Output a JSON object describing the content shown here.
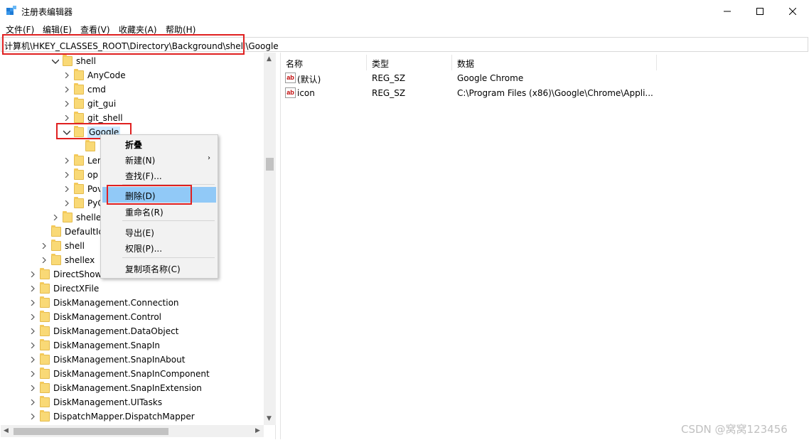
{
  "window": {
    "title": "注册表编辑器",
    "minimize_icon": "minimize-icon",
    "maximize_icon": "maximize-icon",
    "close_icon": "close-icon"
  },
  "menubar": [
    "文件(F)",
    "编辑(E)",
    "查看(V)",
    "收藏夹(A)",
    "帮助(H)"
  ],
  "address": "计算机\\HKEY_CLASSES_ROOT\\Directory\\Background\\shell\\Google",
  "tree": [
    {
      "label": "shell",
      "expanded": true
    },
    {
      "label": "AnyCode"
    },
    {
      "label": "cmd"
    },
    {
      "label": "git_gui"
    },
    {
      "label": "git_shell"
    },
    {
      "label": "Google",
      "expanded": true,
      "selected": true
    },
    {
      "label": ""
    },
    {
      "label": "Ler"
    },
    {
      "label": "op"
    },
    {
      "label": "Pov"
    },
    {
      "label": "PyC"
    },
    {
      "label": "shelle"
    },
    {
      "label": "DefaultIc"
    },
    {
      "label": "shell"
    },
    {
      "label": "shellex"
    },
    {
      "label": "DirectShow"
    },
    {
      "label": "DirectXFile"
    },
    {
      "label": "DiskManagement.Connection"
    },
    {
      "label": "DiskManagement.Control"
    },
    {
      "label": "DiskManagement.DataObject"
    },
    {
      "label": "DiskManagement.SnapIn"
    },
    {
      "label": "DiskManagement.SnapInAbout"
    },
    {
      "label": "DiskManagement.SnapInComponent"
    },
    {
      "label": "DiskManagement.SnapInExtension"
    },
    {
      "label": "DiskManagement.UITasks"
    },
    {
      "label": "DispatchMapper.DispatchMapper"
    }
  ],
  "list": {
    "headers": [
      "名称",
      "类型",
      "数据"
    ],
    "rows": [
      {
        "name": "(默认)",
        "type": "REG_SZ",
        "data": "Google Chrome"
      },
      {
        "name": "icon",
        "type": "REG_SZ",
        "data": "C:\\Program Files (x86)\\Google\\Chrome\\Appli..."
      }
    ]
  },
  "context_menu": {
    "items": [
      "折叠",
      "新建(N)",
      "查找(F)...",
      "删除(D)",
      "重命名(R)",
      "导出(E)",
      "权限(P)...",
      "复制项名称(C)"
    ],
    "highlighted": "删除(D)"
  },
  "watermark": "CSDN @窝窝123456",
  "colors": {
    "highlight": "#91c9f7",
    "annotation_red": "#e02020",
    "folder": "#f9d976"
  }
}
